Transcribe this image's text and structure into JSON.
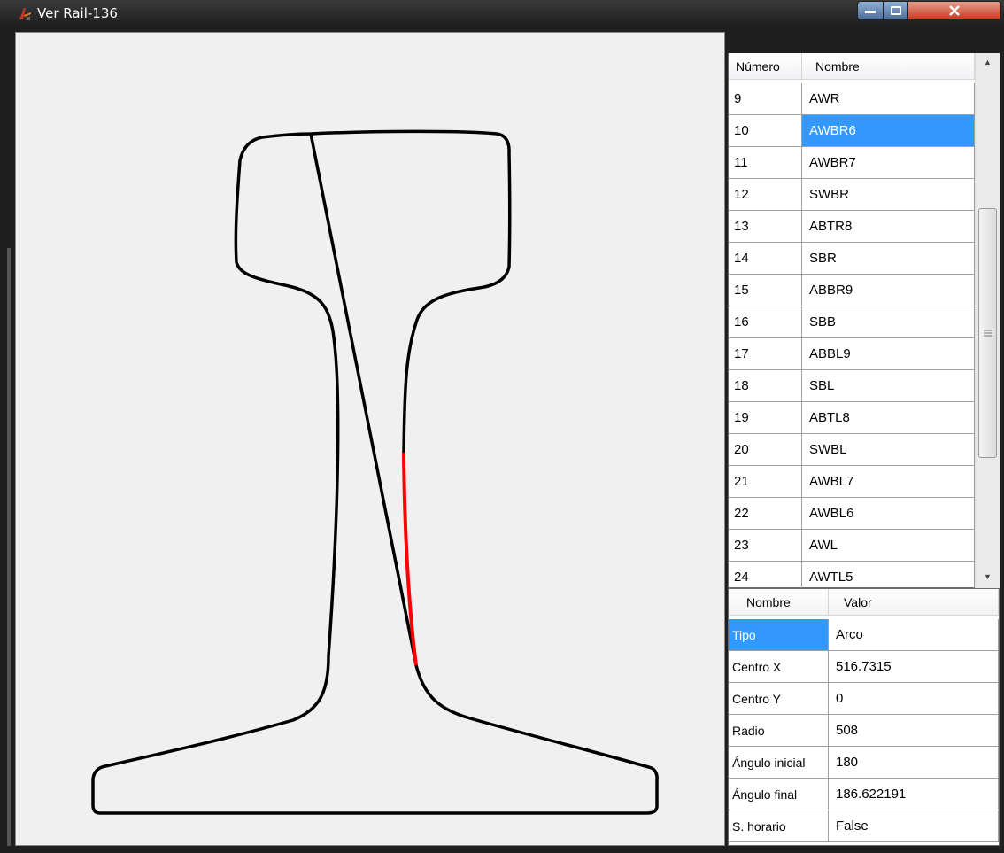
{
  "window": {
    "title": "Ver Rail-136"
  },
  "top_grid": {
    "columns": [
      "Número",
      "Nombre"
    ],
    "rows": [
      {
        "num": "9",
        "name": "AWR",
        "selected": false
      },
      {
        "num": "10",
        "name": "AWBR6",
        "selected": true
      },
      {
        "num": "11",
        "name": "AWBR7",
        "selected": false
      },
      {
        "num": "12",
        "name": "SWBR",
        "selected": false
      },
      {
        "num": "13",
        "name": "ABTR8",
        "selected": false
      },
      {
        "num": "14",
        "name": "SBR",
        "selected": false
      },
      {
        "num": "15",
        "name": "ABBR9",
        "selected": false
      },
      {
        "num": "16",
        "name": "SBB",
        "selected": false
      },
      {
        "num": "17",
        "name": "ABBL9",
        "selected": false
      },
      {
        "num": "18",
        "name": "SBL",
        "selected": false
      },
      {
        "num": "19",
        "name": "ABTL8",
        "selected": false
      },
      {
        "num": "20",
        "name": "SWBL",
        "selected": false
      },
      {
        "num": "21",
        "name": "AWBL7",
        "selected": false
      },
      {
        "num": "22",
        "name": "AWBL6",
        "selected": false
      },
      {
        "num": "23",
        "name": "AWL",
        "selected": false
      },
      {
        "num": "24",
        "name": "AWTL5",
        "selected": false
      }
    ]
  },
  "bottom_grid": {
    "columns": [
      "Nombre",
      "Valor"
    ],
    "rows": [
      {
        "name": "Tipo",
        "value": "Arco",
        "selected": true
      },
      {
        "name": "Centro X",
        "value": "516.7315",
        "selected": false
      },
      {
        "name": "Centro Y",
        "value": "0",
        "selected": false
      },
      {
        "name": "Radio",
        "value": "508",
        "selected": false
      },
      {
        "name": "Ángulo inicial",
        "value": "180",
        "selected": false
      },
      {
        "name": "Ángulo final",
        "value": "186.622191",
        "selected": false
      },
      {
        "name": "S. horario",
        "value": "False",
        "selected": false
      }
    ]
  },
  "colors": {
    "selection": "#3399ff",
    "highlight_segment": "#ff0000",
    "outline": "#000000"
  }
}
